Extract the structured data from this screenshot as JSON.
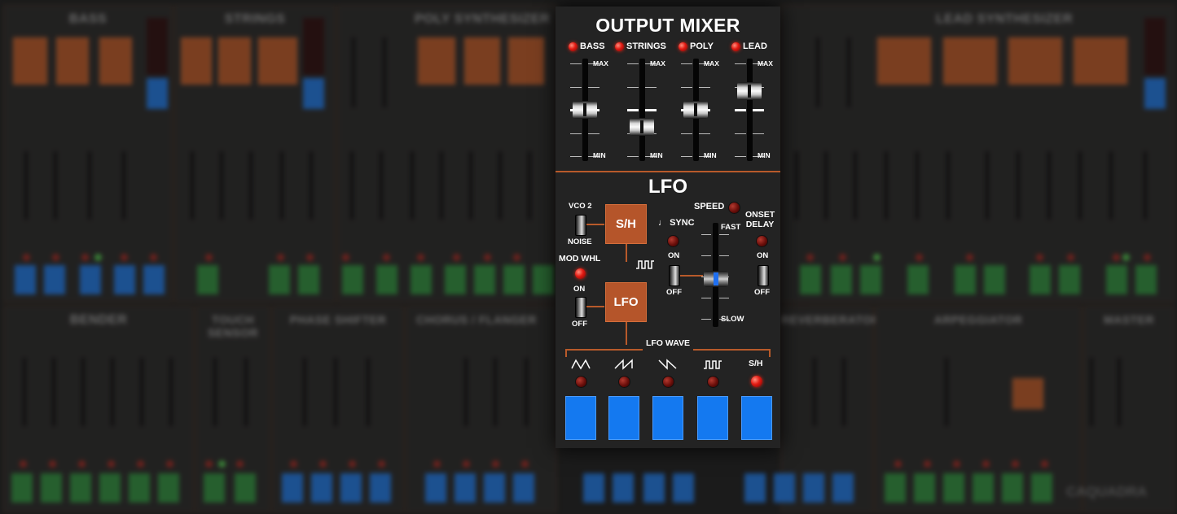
{
  "background": {
    "section_titles": [
      "BASS",
      "STRINGS",
      "POLY SYNTHESIZER",
      "LEAD SYNTHESIZER",
      "BENDER",
      "TOUCH SENSOR",
      "PHASE SHIFTER",
      "CHORUS / FLANGER",
      "REVERBERATOR",
      "ARPEGGIATOR",
      "MASTER"
    ],
    "logo": "CAQUADRA"
  },
  "output_mixer": {
    "title": "OUTPUT MIXER",
    "channels": [
      {
        "label": "BASS",
        "level": 0.5
      },
      {
        "label": "STRINGS",
        "level": 0.3
      },
      {
        "label": "POLY",
        "level": 0.5
      },
      {
        "label": "LEAD",
        "level": 0.72
      }
    ],
    "max_label": "MAX",
    "min_label": "MIN"
  },
  "lfo": {
    "title": "LFO",
    "vco2_label": "VCO 2",
    "noise_label": "NOISE",
    "sh_button": "S/H",
    "lfo_button": "LFO",
    "mod_whl_label": "MOD WHL",
    "on_label": "ON",
    "off_label": "OFF",
    "speed_label": "SPEED",
    "sync_label": "SYNC",
    "fast_label": "FAST",
    "slow_label": "SLOW",
    "onset_delay_label": "ONSET DELAY",
    "speed_level": 0.45,
    "wave_label": "LFO WAVE",
    "waves": [
      {
        "name": "triangle-wave-icon",
        "label": ""
      },
      {
        "name": "ramp-up-wave-icon",
        "label": ""
      },
      {
        "name": "ramp-down-wave-icon",
        "label": ""
      },
      {
        "name": "square-wave-icon",
        "label": ""
      },
      {
        "name": "sample-hold",
        "label": "S/H"
      }
    ],
    "active_wave": 4
  },
  "colors": {
    "accent_orange": "#b5552a",
    "button_blue": "#1479f0",
    "led_red": "#e21a12"
  }
}
